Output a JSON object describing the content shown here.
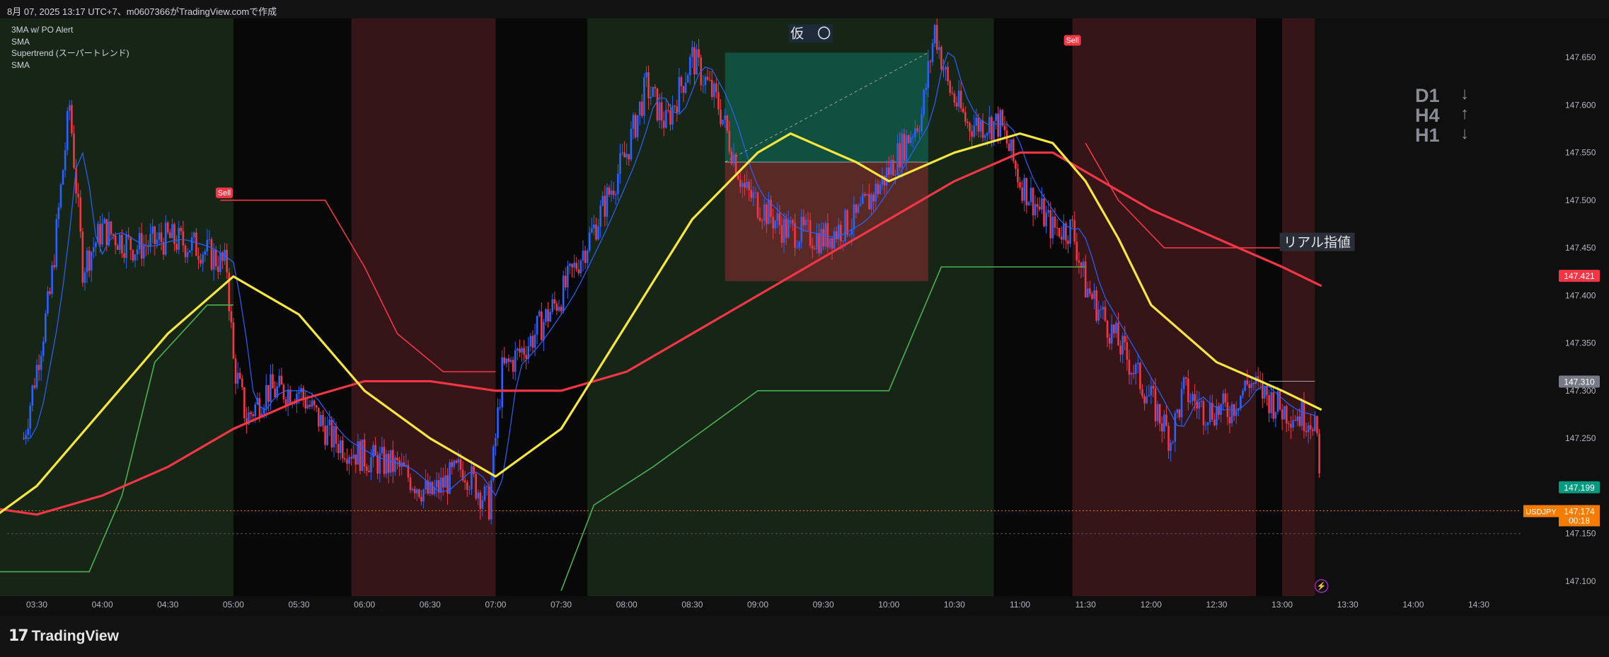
{
  "header": {
    "text": "8月 07, 2025 13:17 UTC+7、m0607366がTradingView.comで作成"
  },
  "legend": {
    "items": [
      "3MA w/ PO Alert",
      "SMA",
      "Supertrend (スーパートレンド)",
      "SMA"
    ]
  },
  "timeframes": [
    {
      "label": "D1",
      "icon": "arrow-down-icon",
      "glyph": "↓"
    },
    {
      "label": "H4",
      "icon": "arrow-up-icon",
      "glyph": "↑"
    },
    {
      "label": "H1",
      "icon": "arrow-down-icon",
      "glyph": "↓"
    }
  ],
  "annotations": {
    "kari": "仮　〇",
    "real_limit": "リアル指値",
    "sell": "Sell"
  },
  "footer": {
    "brand": "TradingView"
  },
  "colors": {
    "sma_fast": "#f5e642",
    "sma_slow": "#f23645",
    "supertrend_up": "#4caf50",
    "supertrend_down": "#f23645",
    "candle_up": "#2962ff",
    "candle_down": "#f23645",
    "last_price": "#f57c00",
    "lines_blue": "#2962ff"
  },
  "chart_data": {
    "type": "candlestick",
    "symbol": "USDJPY",
    "x_ticks": [
      "03:30",
      "04:00",
      "04:30",
      "05:00",
      "05:30",
      "06:00",
      "06:30",
      "07:00",
      "07:30",
      "08:00",
      "08:30",
      "09:00",
      "09:30",
      "10:00",
      "10:30",
      "11:00",
      "11:30",
      "12:00",
      "12:30",
      "13:00",
      "13:30",
      "14:00",
      "14:30"
    ],
    "y_ticks": [
      "147.650",
      "147.600",
      "147.550",
      "147.500",
      "147.450",
      "147.400",
      "147.350",
      "147.300",
      "147.250",
      "147.200",
      "147.150",
      "147.100"
    ],
    "ylim": [
      147.085,
      147.685
    ],
    "price_labels": {
      "red": "147.421",
      "grey": "147.310",
      "green": "147.199",
      "symbol": "USDJPY",
      "last": "147.174",
      "countdown": "00:18"
    },
    "close_path": [
      [
        3.4,
        147.25
      ],
      [
        3.6,
        147.4
      ],
      [
        3.75,
        147.6
      ],
      [
        3.85,
        147.43
      ],
      [
        4.0,
        147.47
      ],
      [
        4.25,
        147.45
      ],
      [
        4.5,
        147.46
      ],
      [
        4.75,
        147.45
      ],
      [
        4.95,
        147.43
      ],
      [
        5.0,
        147.33
      ],
      [
        5.1,
        147.27
      ],
      [
        5.25,
        147.3
      ],
      [
        5.5,
        147.3
      ],
      [
        5.75,
        147.25
      ],
      [
        6.0,
        147.23
      ],
      [
        6.25,
        147.22
      ],
      [
        6.5,
        147.19
      ],
      [
        6.75,
        147.22
      ],
      [
        6.95,
        147.18
      ],
      [
        7.05,
        147.32
      ],
      [
        7.25,
        147.35
      ],
      [
        7.5,
        147.4
      ],
      [
        7.75,
        147.47
      ],
      [
        8.0,
        147.55
      ],
      [
        8.15,
        147.62
      ],
      [
        8.3,
        147.58
      ],
      [
        8.5,
        147.65
      ],
      [
        8.7,
        147.6
      ],
      [
        8.9,
        147.51
      ],
      [
        9.2,
        147.47
      ],
      [
        9.5,
        147.46
      ],
      [
        9.75,
        147.48
      ],
      [
        9.95,
        147.52
      ],
      [
        10.25,
        147.59
      ],
      [
        10.35,
        147.68
      ],
      [
        10.45,
        147.62
      ],
      [
        10.6,
        147.58
      ],
      [
        10.85,
        147.58
      ],
      [
        11.0,
        147.52
      ],
      [
        11.25,
        147.47
      ],
      [
        11.4,
        147.47
      ],
      [
        11.5,
        147.41
      ],
      [
        11.75,
        147.35
      ],
      [
        12.0,
        147.29
      ],
      [
        12.15,
        147.25
      ],
      [
        12.25,
        147.3
      ],
      [
        12.4,
        147.28
      ],
      [
        12.6,
        147.28
      ],
      [
        12.75,
        147.31
      ],
      [
        13.0,
        147.28
      ],
      [
        13.25,
        147.27
      ],
      [
        13.3,
        147.174
      ]
    ],
    "sma_yellow": [
      [
        3.0,
        147.15
      ],
      [
        3.5,
        147.2
      ],
      [
        4.0,
        147.28
      ],
      [
        4.5,
        147.36
      ],
      [
        5.0,
        147.42
      ],
      [
        5.5,
        147.38
      ],
      [
        6.0,
        147.3
      ],
      [
        6.5,
        147.25
      ],
      [
        7.0,
        147.21
      ],
      [
        7.5,
        147.26
      ],
      [
        8.0,
        147.37
      ],
      [
        8.5,
        147.48
      ],
      [
        9.0,
        147.55
      ],
      [
        9.25,
        147.57
      ],
      [
        9.75,
        147.54
      ],
      [
        10.0,
        147.52
      ],
      [
        10.5,
        147.55
      ],
      [
        11.0,
        147.57
      ],
      [
        11.25,
        147.56
      ],
      [
        11.5,
        147.52
      ],
      [
        11.75,
        147.46
      ],
      [
        12.0,
        147.39
      ],
      [
        12.5,
        147.33
      ],
      [
        13.0,
        147.3
      ],
      [
        13.3,
        147.28
      ]
    ],
    "sma_red": [
      [
        3.0,
        147.18
      ],
      [
        3.5,
        147.17
      ],
      [
        4.0,
        147.19
      ],
      [
        4.5,
        147.22
      ],
      [
        5.0,
        147.26
      ],
      [
        5.5,
        147.29
      ],
      [
        6.0,
        147.31
      ],
      [
        6.5,
        147.31
      ],
      [
        7.0,
        147.3
      ],
      [
        7.5,
        147.3
      ],
      [
        8.0,
        147.32
      ],
      [
        8.5,
        147.36
      ],
      [
        9.0,
        147.4
      ],
      [
        9.5,
        147.44
      ],
      [
        10.0,
        147.48
      ],
      [
        10.5,
        147.52
      ],
      [
        11.0,
        147.55
      ],
      [
        11.25,
        147.55
      ],
      [
        11.5,
        147.53
      ],
      [
        12.0,
        147.49
      ],
      [
        12.5,
        147.46
      ],
      [
        13.0,
        147.43
      ],
      [
        13.3,
        147.41
      ]
    ],
    "supertrend_segments": [
      {
        "dir": "up",
        "points": [
          [
            3.0,
            147.11
          ],
          [
            3.9,
            147.11
          ],
          [
            4.15,
            147.19
          ],
          [
            4.4,
            147.33
          ],
          [
            4.8,
            147.39
          ],
          [
            5.0,
            147.39
          ]
        ]
      },
      {
        "dir": "down",
        "points": [
          [
            4.9,
            147.5
          ],
          [
            5.7,
            147.5
          ],
          [
            6.0,
            147.43
          ],
          [
            6.25,
            147.36
          ],
          [
            6.6,
            147.32
          ],
          [
            7.0,
            147.32
          ]
        ]
      },
      {
        "dir": "up",
        "points": [
          [
            7.5,
            147.09
          ],
          [
            7.75,
            147.18
          ],
          [
            8.2,
            147.22
          ],
          [
            8.6,
            147.26
          ],
          [
            9.0,
            147.3
          ],
          [
            10.0,
            147.3
          ],
          [
            10.4,
            147.43
          ],
          [
            11.5,
            147.43
          ]
        ]
      },
      {
        "dir": "down",
        "points": [
          [
            11.5,
            147.56
          ],
          [
            11.75,
            147.5
          ],
          [
            12.1,
            147.45
          ],
          [
            13.3,
            147.45
          ]
        ]
      }
    ],
    "sessions": [
      {
        "x0": 3.0,
        "x1": 5.0,
        "color": "green"
      },
      {
        "x0": 5.0,
        "x1": 5.9,
        "color": "black"
      },
      {
        "x0": 5.9,
        "x1": 7.0,
        "color": "red"
      },
      {
        "x0": 7.0,
        "x1": 7.7,
        "color": "black"
      },
      {
        "x0": 7.7,
        "x1": 8.95,
        "color": "green"
      },
      {
        "x0": 8.95,
        "x1": 10.0,
        "color": "green"
      },
      {
        "x0": 10.0,
        "x1": 10.8,
        "color": "green"
      },
      {
        "x0": 10.8,
        "x1": 11.4,
        "color": "black"
      },
      {
        "x0": 11.4,
        "x1": 12.8,
        "color": "red"
      },
      {
        "x0": 12.8,
        "x1": 13.0,
        "color": "black"
      },
      {
        "x0": 13.0,
        "x1": 13.25,
        "color": "red"
      }
    ],
    "positions": [
      {
        "label": "仮　〇",
        "x0": 8.75,
        "x1": 10.3,
        "entry": 147.54,
        "target": 147.655,
        "stop": 147.415
      },
      {
        "label": "リアル指値",
        "x0": 12.9,
        "x1": 13.25,
        "entry": 147.31,
        "target": 147.199,
        "stop": 147.421
      }
    ],
    "sell_signals": [
      {
        "x": 4.93,
        "price": 147.5
      },
      {
        "x": 11.4,
        "price": 147.66
      }
    ]
  }
}
